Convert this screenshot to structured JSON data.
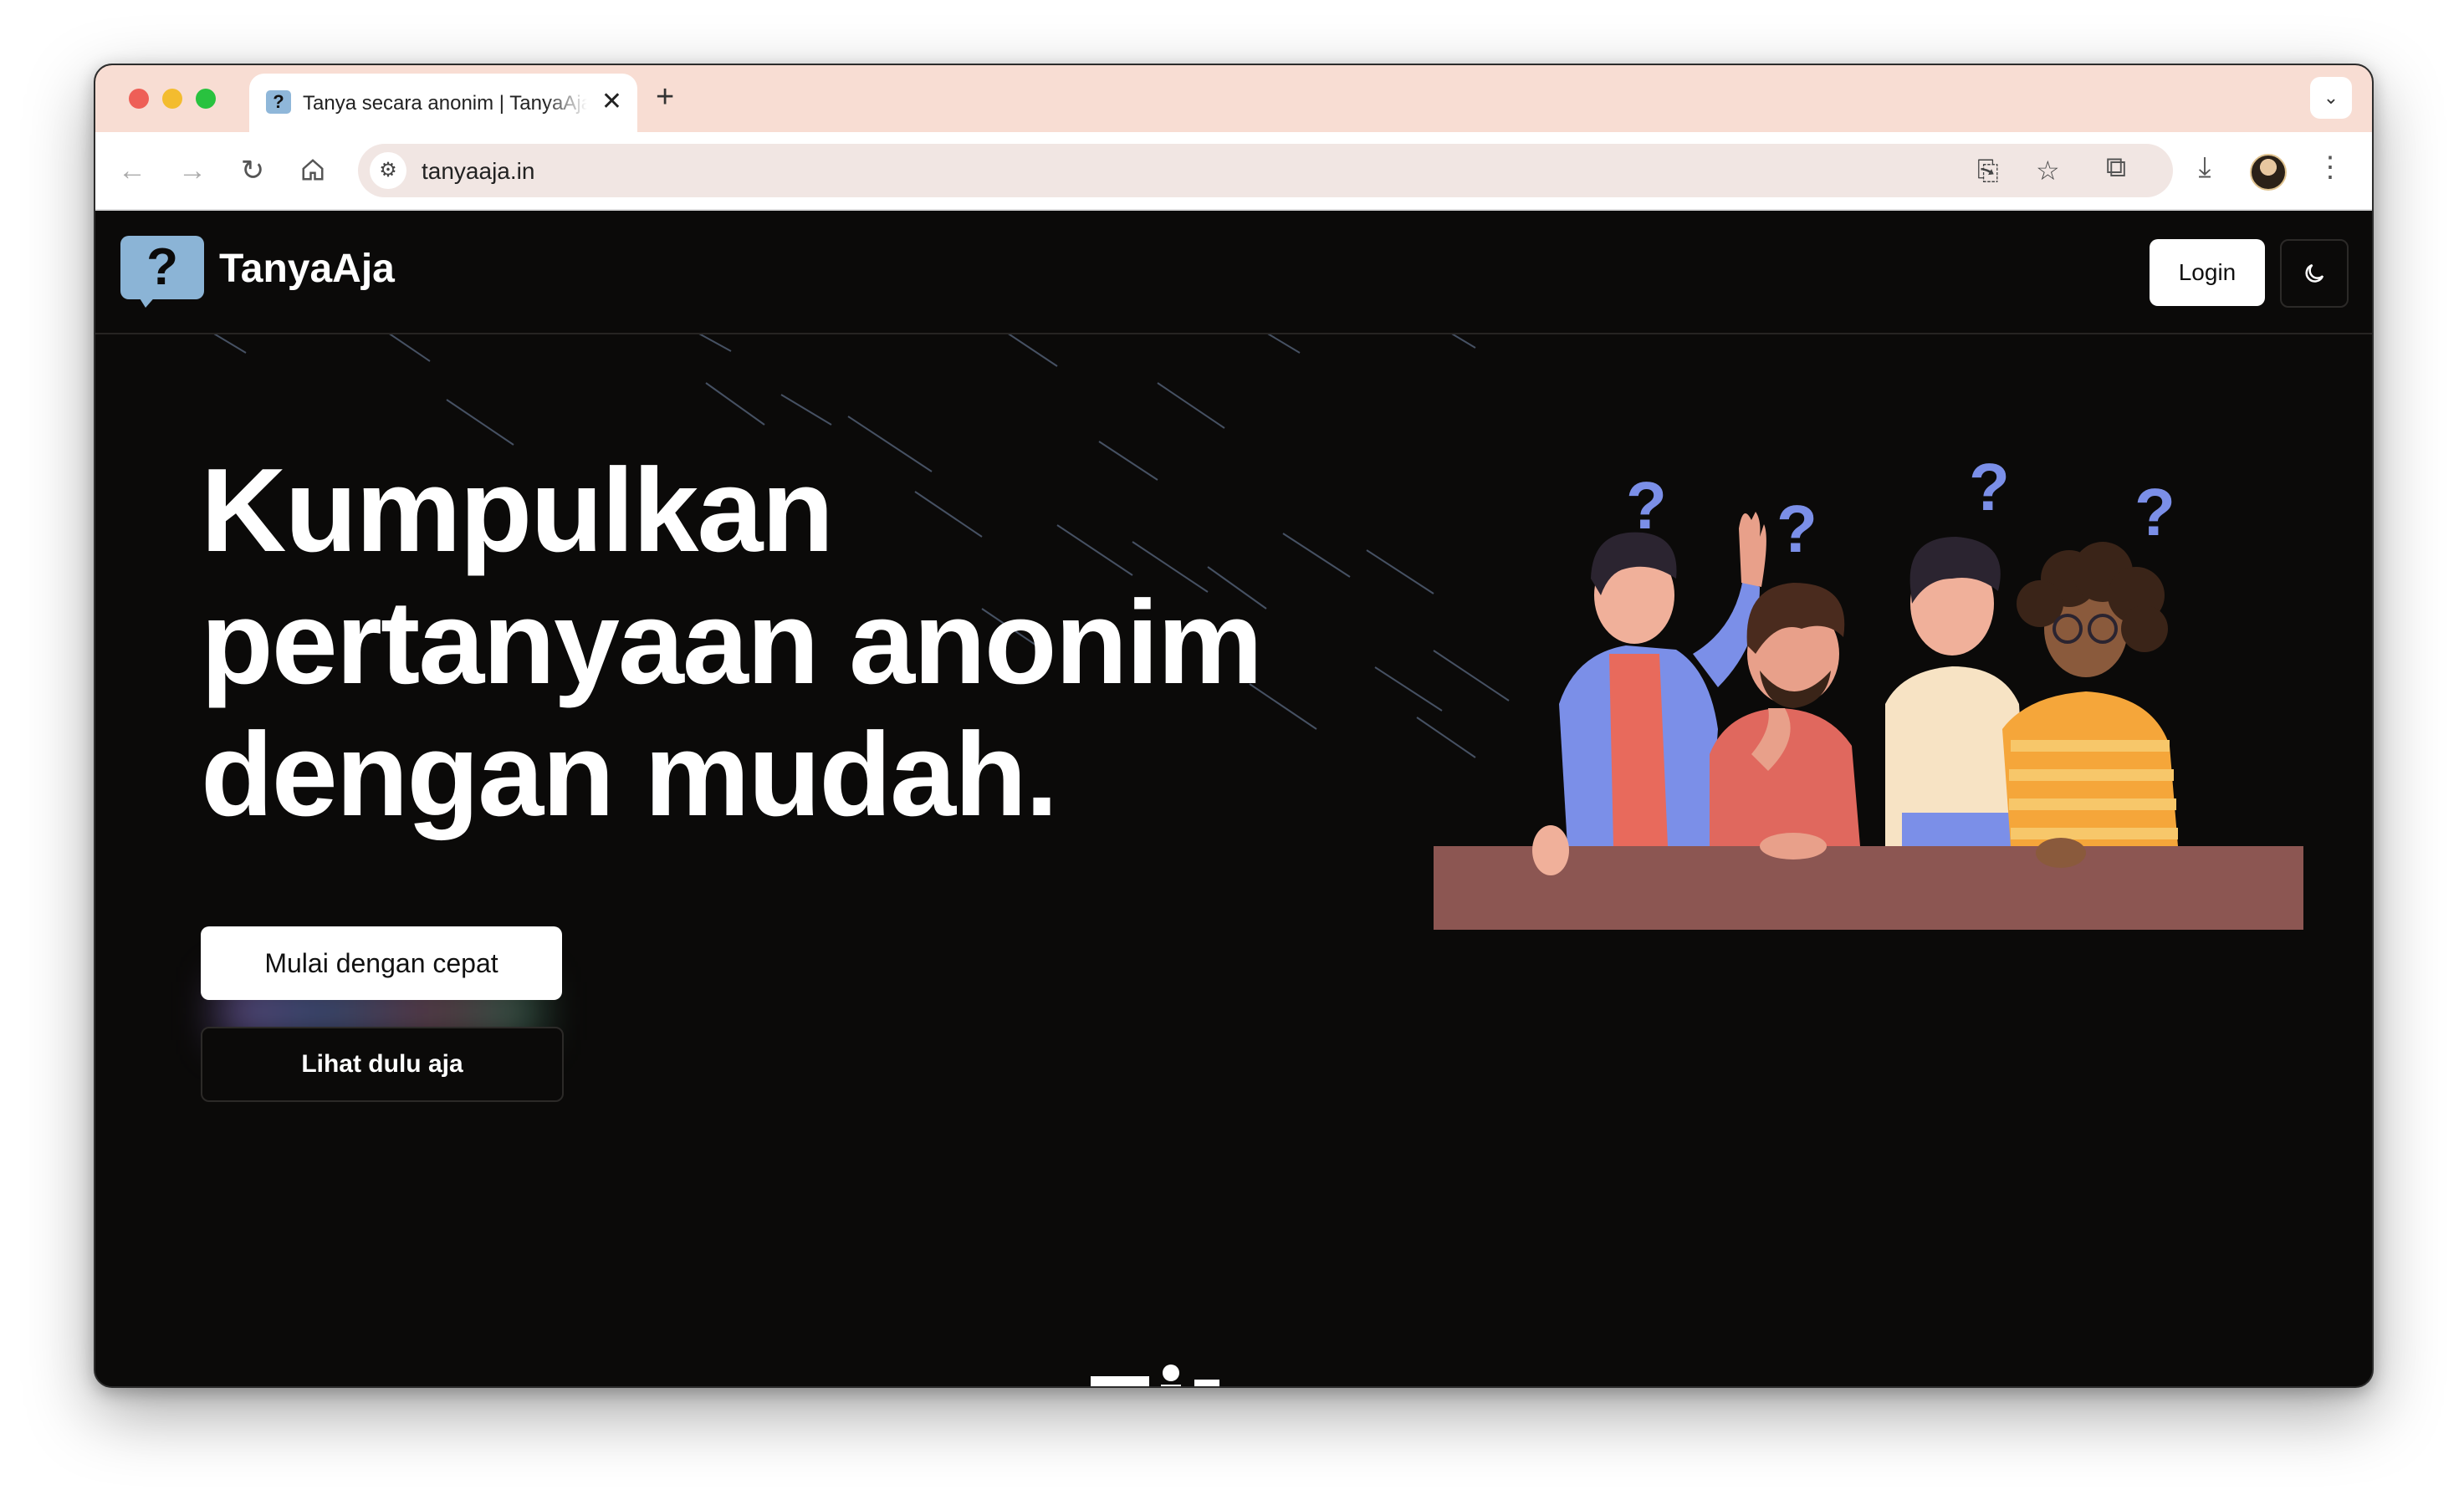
{
  "browser": {
    "tab_title": "Tanya secara anonim | TanyaAja",
    "url": "tanyaaja.in",
    "new_tab": "+",
    "close": "✕",
    "tab_menu": "⌄"
  },
  "nav": {
    "brand": "TanyaAja",
    "logo_glyph": "?",
    "login_label": "Login",
    "theme_icon": "moon-icon"
  },
  "hero": {
    "line1": "Kumpulkan",
    "line2": "pertanyaan anonim",
    "line3": "dengan mudah.",
    "primary_cta": "Mulai dengan cepat",
    "secondary_cta": "Lihat dulu aja"
  },
  "illustration": {
    "question_mark": "?"
  },
  "colors": {
    "tab_strip": "#f8ddd3",
    "page_bg": "#0b0a09",
    "logo": "#8bb4d6",
    "table": "#8c5652",
    "question_marks": "#7b8fe8"
  }
}
